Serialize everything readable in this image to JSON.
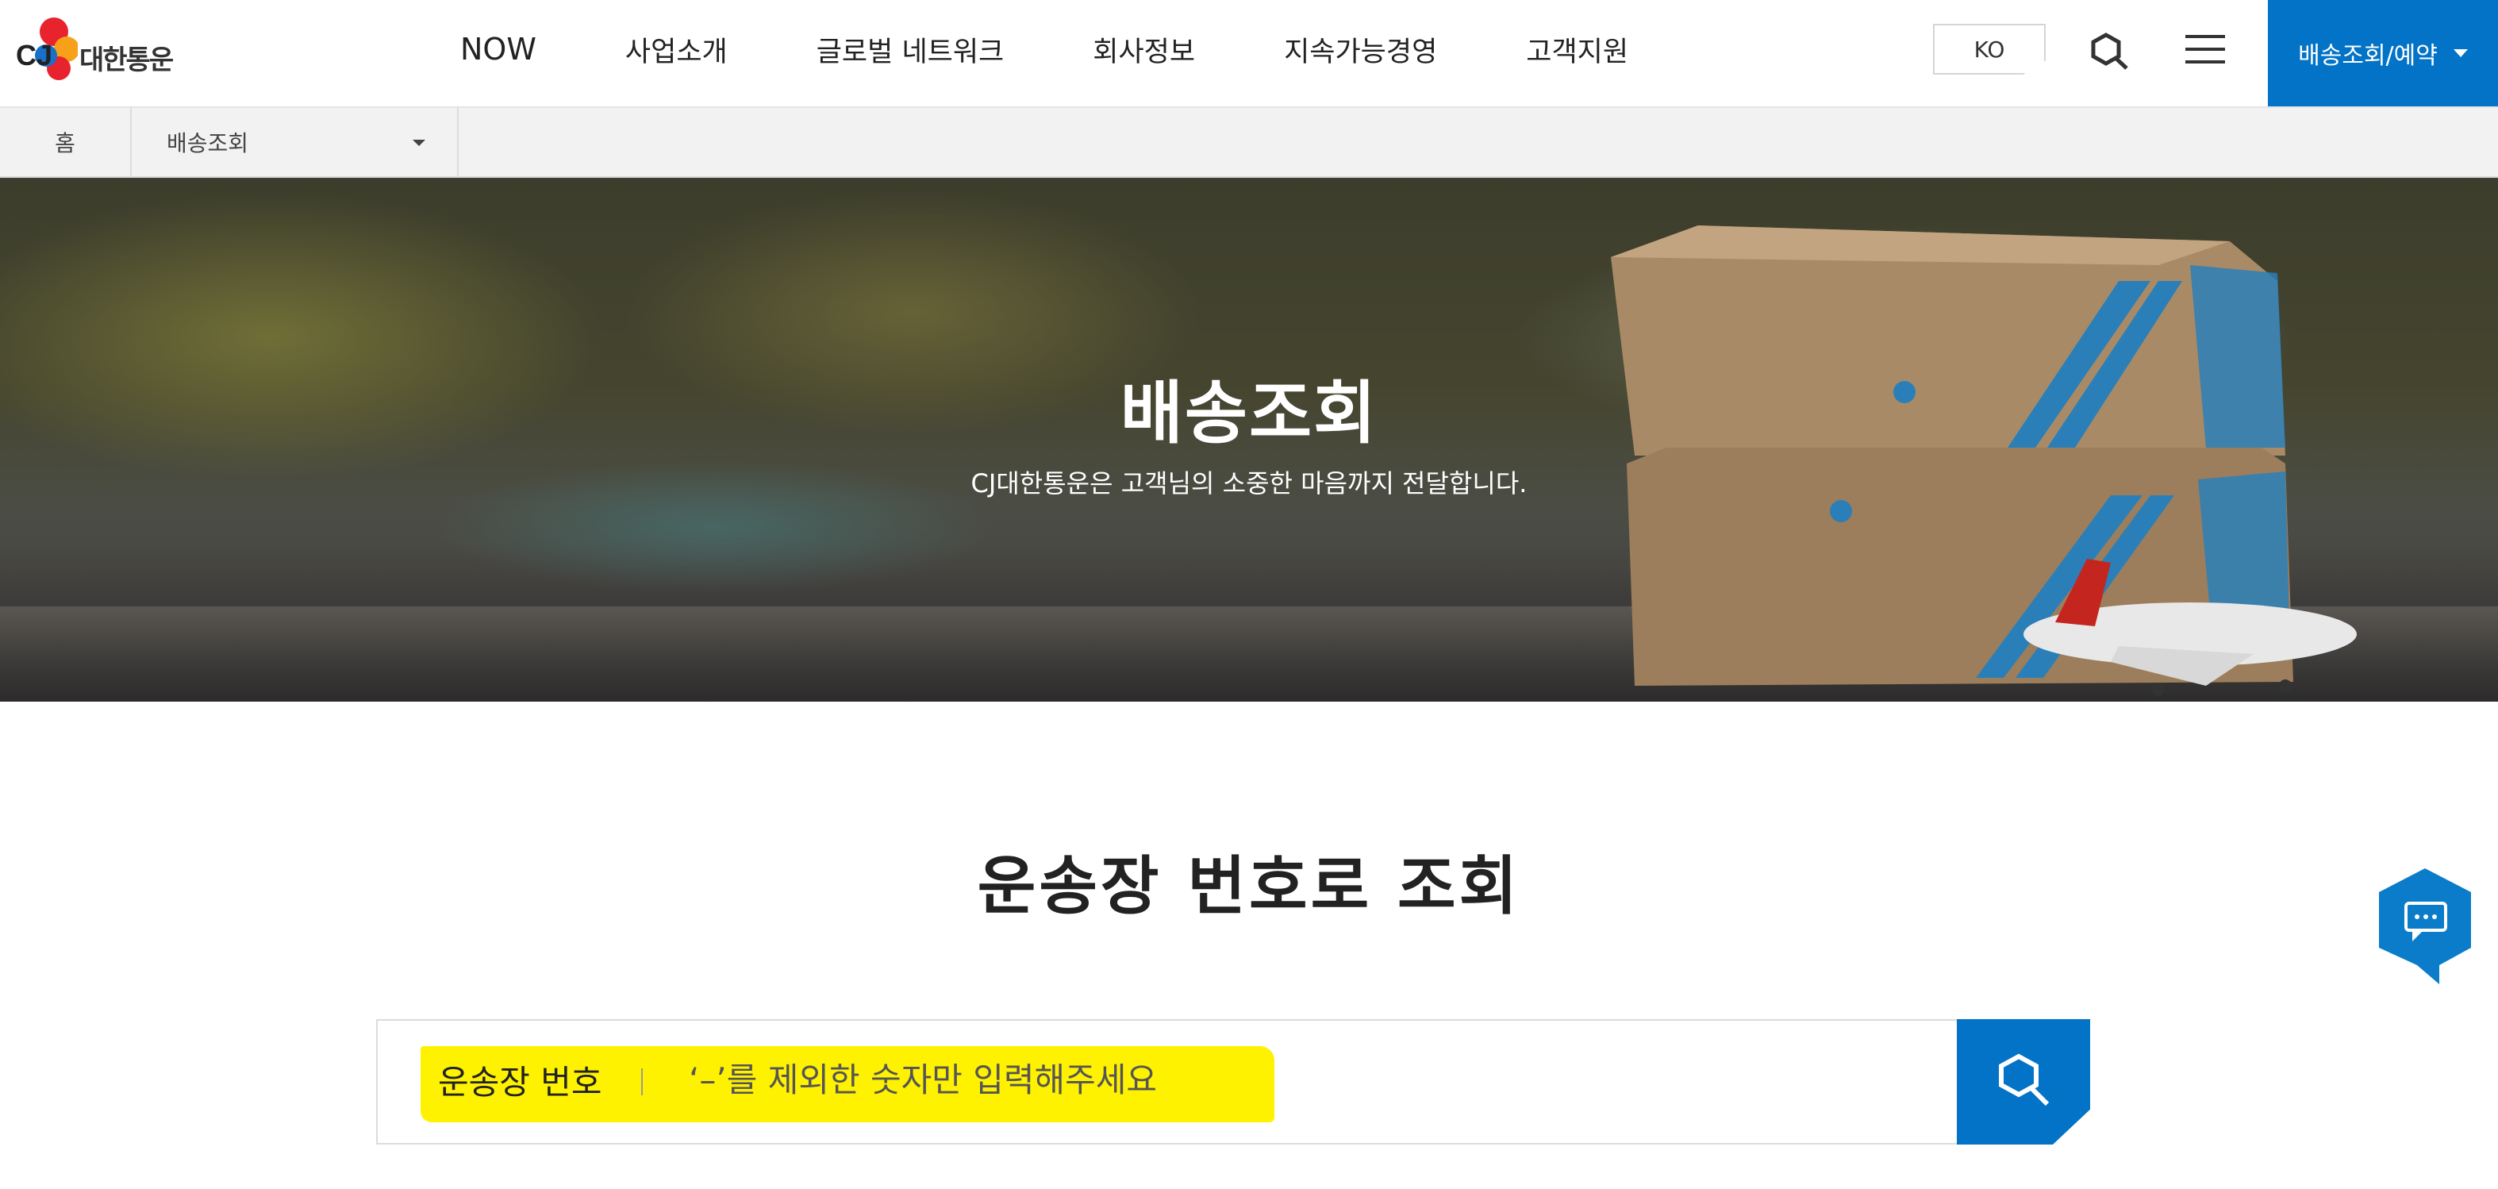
{
  "brand": {
    "logo_text": "대한통운",
    "logo_mark": "CJ"
  },
  "nav": {
    "items": [
      {
        "label": "NOW"
      },
      {
        "label": "사업소개"
      },
      {
        "label": "글로벌 네트워크"
      },
      {
        "label": "회사정보"
      },
      {
        "label": "지속가능경영"
      },
      {
        "label": "고객지원"
      }
    ],
    "lang": "KO",
    "cta": "배송조회/예약"
  },
  "breadcrumb": {
    "home": "홈",
    "current": "배송조회"
  },
  "hero": {
    "title": "배송조회",
    "subtitle": "CJ대한통운은 고객님의 소중한 마음까지 전달합니다."
  },
  "tracking": {
    "title": "운송장 번호로 조회",
    "field_label": "운송장 번호",
    "placeholder": "‘–’를 제외한 숫자만 입력해주세요",
    "value": ""
  },
  "colors": {
    "brand_blue": "#0273c6",
    "highlight": "#fff200"
  },
  "icons": [
    "search-icon",
    "menu-icon",
    "chat-icon",
    "caret-down-icon"
  ]
}
